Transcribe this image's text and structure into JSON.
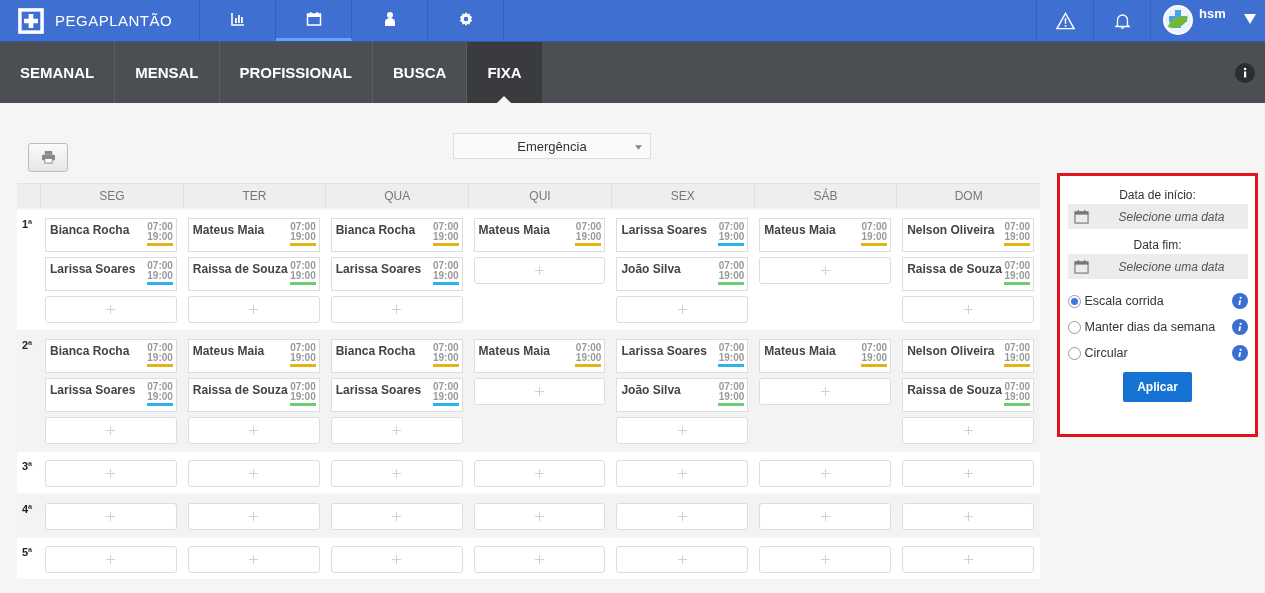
{
  "app": {
    "name": "PEGAPLANTÃO"
  },
  "nav_icons": [
    {
      "kind": "chart",
      "selected": false
    },
    {
      "kind": "calendar",
      "selected": true
    },
    {
      "kind": "person",
      "selected": false
    },
    {
      "kind": "gear",
      "selected": false
    }
  ],
  "user": {
    "name": "hsm"
  },
  "tabs": [
    {
      "label": "SEMANAL",
      "selected": false
    },
    {
      "label": "MENSAL",
      "selected": false
    },
    {
      "label": "PROFISSIONAL",
      "selected": false
    },
    {
      "label": "BUSCA",
      "selected": false
    },
    {
      "label": "FIXA",
      "selected": true
    }
  ],
  "sector_select": {
    "value": "Emergência"
  },
  "days": [
    "SEG",
    "TER",
    "QUA",
    "QUI",
    "SEX",
    "SÁB",
    "DOM"
  ],
  "weeks": [
    {
      "label": "1ª",
      "days": [
        [
          {
            "name": "Bianca Rocha",
            "start": "07:00",
            "end": "19:00",
            "color": "#e2b414"
          },
          {
            "name": "Larissa Soares",
            "start": "07:00",
            "end": "19:00",
            "color": "#2cb4e8"
          }
        ],
        [
          {
            "name": "Mateus Maia",
            "start": "07:00",
            "end": "19:00",
            "color": "#e2b414"
          },
          {
            "name": "Raissa de Souza",
            "start": "07:00",
            "end": "19:00",
            "color": "#6dcc72"
          }
        ],
        [
          {
            "name": "Bianca Rocha",
            "start": "07:00",
            "end": "19:00",
            "color": "#e2b414"
          },
          {
            "name": "Larissa Soares",
            "start": "07:00",
            "end": "19:00",
            "color": "#2cb4e8"
          }
        ],
        [
          {
            "name": "Mateus Maia",
            "start": "07:00",
            "end": "19:00",
            "color": "#e2b414"
          }
        ],
        [
          {
            "name": "Larissa Soares",
            "start": "07:00",
            "end": "19:00",
            "color": "#2cb4e8"
          },
          {
            "name": "João Silva",
            "start": "07:00",
            "end": "19:00",
            "color": "#6dcc72"
          }
        ],
        [
          {
            "name": "Mateus Maia",
            "start": "07:00",
            "end": "19:00",
            "color": "#e2b414"
          }
        ],
        [
          {
            "name": "Nelson Oliveira",
            "start": "07:00",
            "end": "19:00",
            "color": "#e2b414"
          },
          {
            "name": "Raissa de Souza",
            "start": "07:00",
            "end": "19:00",
            "color": "#6dcc72"
          }
        ]
      ]
    },
    {
      "label": "2ª",
      "days": [
        [
          {
            "name": "Bianca Rocha",
            "start": "07:00",
            "end": "19:00",
            "color": "#e2b414"
          },
          {
            "name": "Larissa Soares",
            "start": "07:00",
            "end": "19:00",
            "color": "#2cb4e8"
          }
        ],
        [
          {
            "name": "Mateus Maia",
            "start": "07:00",
            "end": "19:00",
            "color": "#e2b414"
          },
          {
            "name": "Raissa de Souza",
            "start": "07:00",
            "end": "19:00",
            "color": "#6dcc72"
          }
        ],
        [
          {
            "name": "Bianca Rocha",
            "start": "07:00",
            "end": "19:00",
            "color": "#e2b414"
          },
          {
            "name": "Larissa Soares",
            "start": "07:00",
            "end": "19:00",
            "color": "#2cb4e8"
          }
        ],
        [
          {
            "name": "Mateus Maia",
            "start": "07:00",
            "end": "19:00",
            "color": "#e2b414"
          }
        ],
        [
          {
            "name": "Larissa Soares",
            "start": "07:00",
            "end": "19:00",
            "color": "#2cb4e8"
          },
          {
            "name": "João Silva",
            "start": "07:00",
            "end": "19:00",
            "color": "#6dcc72"
          }
        ],
        [
          {
            "name": "Mateus Maia",
            "start": "07:00",
            "end": "19:00",
            "color": "#e2b414"
          }
        ],
        [
          {
            "name": "Nelson Oliveira",
            "start": "07:00",
            "end": "19:00",
            "color": "#e2b414"
          },
          {
            "name": "Raissa de Souza",
            "start": "07:00",
            "end": "19:00",
            "color": "#6dcc72"
          }
        ]
      ]
    },
    {
      "label": "3ª"
    },
    {
      "label": "4ª"
    },
    {
      "label": "5ª"
    }
  ],
  "panel": {
    "start_label": "Data de início:",
    "start_placeholder": "Selecione uma data",
    "end_label": "Data fim:",
    "end_placeholder": "Selecione uma data",
    "options": [
      {
        "label": "Escala corrida",
        "selected": true
      },
      {
        "label": "Manter dias da semana",
        "selected": false
      },
      {
        "label": "Circular",
        "selected": false
      }
    ],
    "apply": "Aplicar"
  }
}
